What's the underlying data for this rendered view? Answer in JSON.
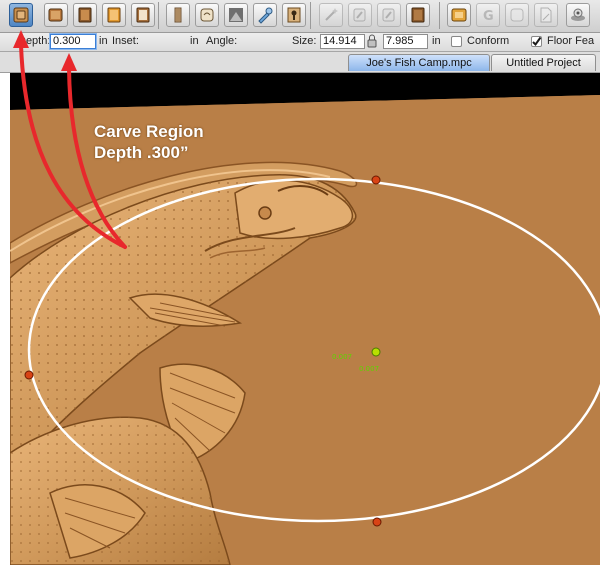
{
  "toolbar": {
    "icons": [
      "carve-region-icon",
      "stack-layer-icon",
      "book-layer-icon",
      "notebook-layer-icon",
      "page-layer-icon",
      "column-icon",
      "scroll-icon",
      "texture-icon",
      "paint-brush-icon",
      "key-icon",
      "wand-icon",
      "layer-copy-icon",
      "layer-paste-icon",
      "book-icon",
      "stamp-icon",
      "letter-g-icon",
      "rounded-square-icon",
      "document-icon",
      "sheep-icon"
    ]
  },
  "properties": {
    "depth_label": "Depth:",
    "depth_value": "0.300",
    "depth_unit": "in",
    "inset_label": "Inset:",
    "inset_value": "",
    "inset_unit": "in",
    "angle_label": "Angle:",
    "size_label": "Size:",
    "width_value": "14.914",
    "height_value": "7.985",
    "size_unit": "in",
    "conform_label": "Conform",
    "conform_checked": false,
    "floor_label": "Floor Fea",
    "floor_checked": true
  },
  "tabs": [
    {
      "label": "Joe's Fish Camp.mpc",
      "active": true
    },
    {
      "label": "Untitled Project",
      "active": false
    }
  ],
  "annotation": {
    "line1": "Carve Region",
    "line2": "Depth .300”"
  },
  "readouts": {
    "left": "0.007",
    "bottom": "0.007"
  },
  "colors": {
    "wood": "#b97f47",
    "selection": "#ffffff",
    "handle": "#d84315",
    "arrow": "#e8282c",
    "readout": "#5fd400"
  }
}
